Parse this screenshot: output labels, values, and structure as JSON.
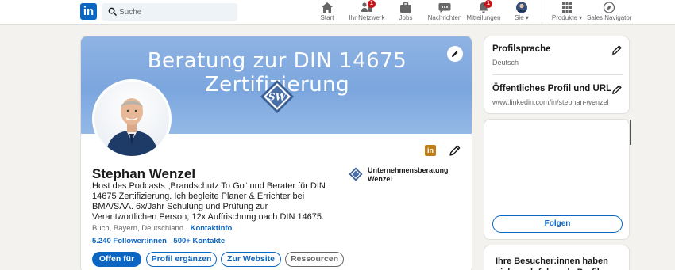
{
  "nav": {
    "logo_text": "in",
    "search_placeholder": "Suche",
    "items": [
      {
        "label": "Start",
        "badge": ""
      },
      {
        "label": "Ihr Netzwerk",
        "badge": "1"
      },
      {
        "label": "Jobs",
        "badge": ""
      },
      {
        "label": "Nachrichten",
        "badge": ""
      },
      {
        "label": "Mitteilungen",
        "badge": "1"
      },
      {
        "label": "Sie",
        "badge": ""
      },
      {
        "label": "Produkte",
        "badge": ""
      },
      {
        "label": "Sales Navigator",
        "badge": ""
      }
    ]
  },
  "profile": {
    "banner_title": "Beratung zur DIN 14675 Zertifizierung",
    "banner_logo_text": "SW",
    "name": "Stephan Wenzel",
    "headline": "Host des Podcasts „Brandschutz To Go“ und Berater für DIN 14675 Zertifizierung. Ich begleite Planer & Errichter bei BMA/SAA. 6x/Jahr Schulung und Prüfung zur Verantwortlichen Person, 12x Auffrischung nach DIN 14675.",
    "location": "Buch, Bayern, Deutschland",
    "contact_link": "Kontaktinfo",
    "followers": "5.240 Follower:innen",
    "connections": "500+ Kontakte",
    "company": "Unternehmensberatung Wenzel",
    "li_badge": "in",
    "buttons": {
      "open_to": "Offen für",
      "add_profile": "Profil ergänzen",
      "website": "Zur Website",
      "resources": "Ressourcen"
    }
  },
  "sidebar": {
    "profile_language_title": "Profilsprache",
    "profile_language_value": "Deutsch",
    "public_profile_title": "Öffentliches Profil und URL",
    "public_profile_url": "www.linkedin.com/in/stephan-wenzel",
    "follow_button": "Folgen",
    "visitors_title": "Ihre Besucher:innen haben sich auch folgende Profile"
  },
  "colors": {
    "brand": "#0a66c2",
    "badge": "#cc1016",
    "banner": "#7ba6de",
    "premium_badge": "#c37d16"
  }
}
